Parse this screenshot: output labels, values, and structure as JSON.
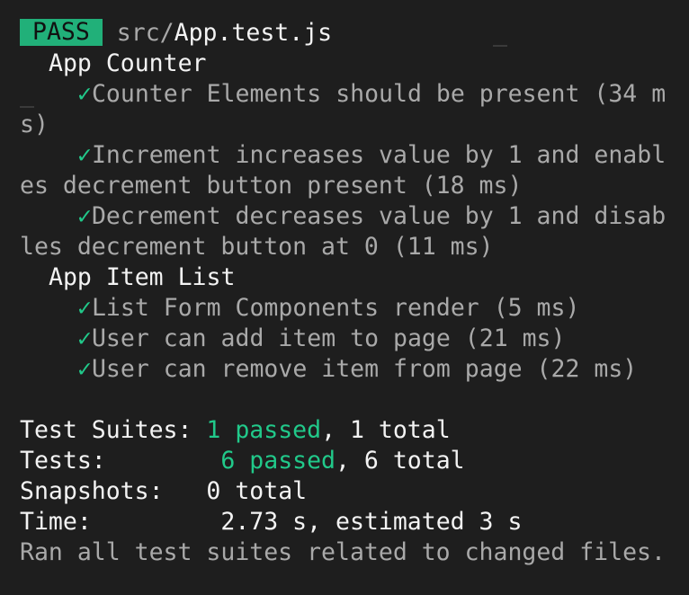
{
  "header": {
    "status": "PASS",
    "path_dir": "src/",
    "path_file": "App.test.js"
  },
  "suites": [
    {
      "name": "App Counter",
      "tests": [
        {
          "check": "✓",
          "line1": "Counter Elements should be present (34 m",
          "line2": "s)"
        },
        {
          "check": "✓",
          "line1": "Increment increases value by 1 and enabl",
          "line2": "es decrement button present (18 ms)"
        },
        {
          "check": "✓",
          "line1": "Decrement decreases value by 1 and disab",
          "line2": "les decrement button at 0 (11 ms)"
        }
      ]
    },
    {
      "name": "App Item List",
      "tests": [
        {
          "check": "✓",
          "line1": "List Form Components render (5 ms)"
        },
        {
          "check": "✓",
          "line1": "User can add item to page (21 ms)"
        },
        {
          "check": "✓",
          "line1": "User can remove item from page (22 ms)"
        }
      ]
    }
  ],
  "summary": {
    "suites_label": "Test Suites:",
    "suites_passed": "1 passed",
    "suites_total": ", 1 total",
    "tests_label": "Tests:",
    "tests_passed": "6 passed",
    "tests_total": ", 6 total",
    "snapshots_label": "Snapshots:",
    "snapshots_value": "0 total",
    "time_label": "Time:",
    "time_value": "2.73 s, estimated 3 s",
    "footer": "Ran all test suites related to changed files."
  },
  "colors": {
    "background": "#1e1e1e",
    "pass_badge": "#21b079",
    "passed_text": "#21c98a"
  }
}
